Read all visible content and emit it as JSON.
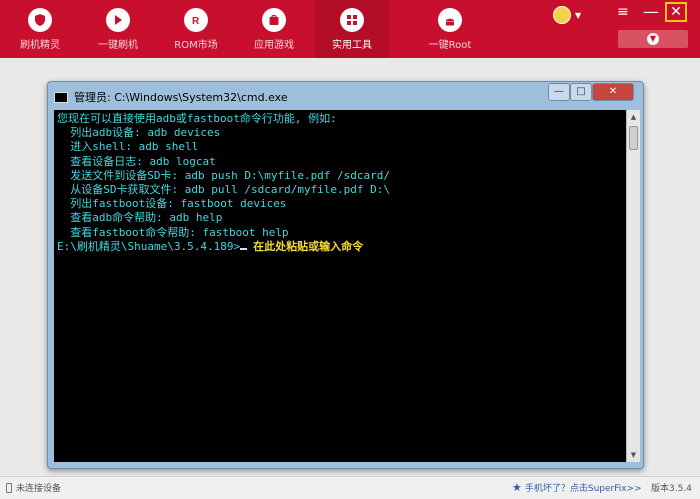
{
  "nav": {
    "items": [
      {
        "label": "刷机精灵",
        "icon": "shield-icon"
      },
      {
        "label": "一键刷机",
        "icon": "play-icon"
      },
      {
        "label": "ROM市场",
        "icon": "rom-icon"
      },
      {
        "label": "应用游戏",
        "icon": "bag-icon"
      },
      {
        "label": "实用工具",
        "icon": "grid-icon",
        "active": true
      },
      {
        "label": "一键Root",
        "icon": "android-icon"
      }
    ]
  },
  "window_controls": {
    "menu": "≡",
    "minimize": "—",
    "close": "✕"
  },
  "cmd_window": {
    "title": "管理员: C:\\Windows\\System32\\cmd.exe",
    "buttons": {
      "minimize": "—",
      "maximize": "□",
      "close": "✕"
    },
    "lines": [
      "您现在可以直接使用adb或fastboot命令行功能, 例如:",
      "",
      "  列出adb设备: adb devices",
      "  进入shell: adb shell",
      "  查看设备日志: adb logcat",
      "  发送文件到设备SD卡: adb push D:\\myfile.pdf /sdcard/",
      "  从设备SD卡获取文件: adb pull /sdcard/myfile.pdf D:\\",
      "  列出fastboot设备: fastboot devices",
      "  查看adb命令帮助: adb help",
      "  查看fastboot命令帮助: fastboot help",
      ""
    ],
    "prompt": "E:\\刷机精灵\\Shuame\\3.5.4.189>",
    "prompt_hint": "在此处粘贴或输入命令"
  },
  "statusbar": {
    "connection": "未连接设备",
    "superfix": "手机坏了？点击SuperFix>>",
    "version": "版本3.5.4"
  },
  "colors": {
    "brand_red": "#c8102e",
    "console_text": "#3fd8df",
    "hint_yellow": "#f5dc33"
  }
}
